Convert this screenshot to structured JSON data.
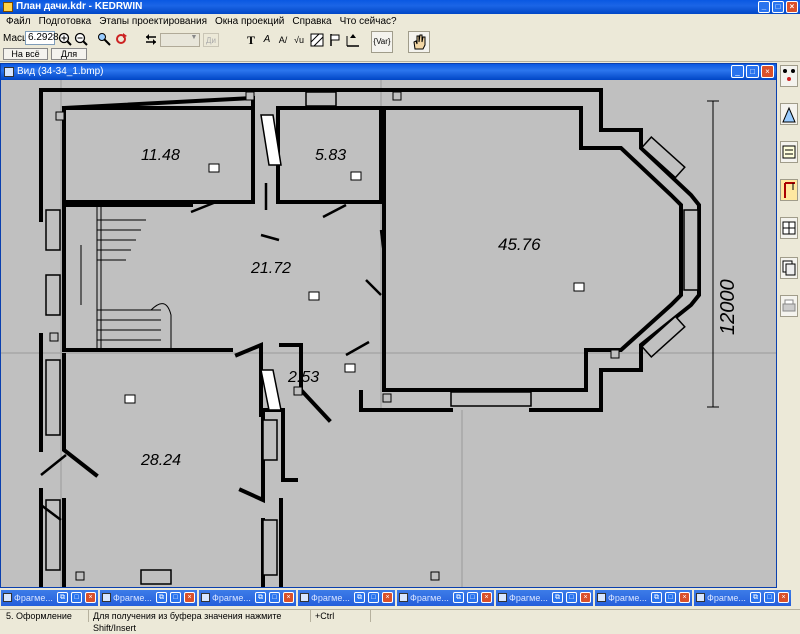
{
  "window": {
    "title": "План дачи.kdr - KEDRWIN",
    "minimize": "_",
    "maximize": "□",
    "close": "×"
  },
  "menu": [
    "Файл",
    "Подготовка",
    "Этапы проектирования",
    "Окна проекций",
    "Справка",
    "Что сейчас?"
  ],
  "toolbar": {
    "scale_label": "Масшт",
    "scale_value": "6.2928",
    "fit_window_label": "На всё окно",
    "for_all_label": "Для всех",
    "disabled_btn": "Ди",
    "variable_btn": "{Var}",
    "text_tool": "T",
    "icons": [
      "zoom-in-icon",
      "zoom-out-icon",
      "pan-tool-icon",
      "refresh-icon",
      "swap-arrows-icon",
      "text-tool-icon",
      "text-angle-icon",
      "text-style-icon",
      "math-root-icon",
      "hatch-icon",
      "flag-icon",
      "dimension-icon",
      "variable-icon",
      "hand-icon"
    ]
  },
  "view_window": {
    "title": "Вид (34-34_1.bmp)"
  },
  "plan": {
    "rooms": [
      {
        "label": "11.48"
      },
      {
        "label": "5.83"
      },
      {
        "label": "45.76"
      },
      {
        "label": "21.72"
      },
      {
        "label": "2.53"
      },
      {
        "label": "28.24"
      }
    ],
    "dimension_label": "12000",
    "colors": {
      "background": "#c0c0c0",
      "walls": "#000000",
      "lines": "#555555"
    }
  },
  "taskbar": {
    "fragment_label": "Фрагме...",
    "fragments": [
      "Фрагме...",
      "Фрагме...",
      "Фрагме...",
      "Фрагме...",
      "Фрагме...",
      "Фрагме...",
      "Фрагме...",
      "Фрагме..."
    ]
  },
  "status": {
    "stage": "5. Оформление",
    "hint": "Для получения из буфера значения нажмите Shift/Insert",
    "modifier": "+Ctrl"
  },
  "right_toolbar_icons": [
    "grid-snap-icon",
    "view-icon",
    "text-block-icon",
    "crane-icon",
    "table-icon",
    "copy-fragment-icon",
    "print-icon"
  ]
}
